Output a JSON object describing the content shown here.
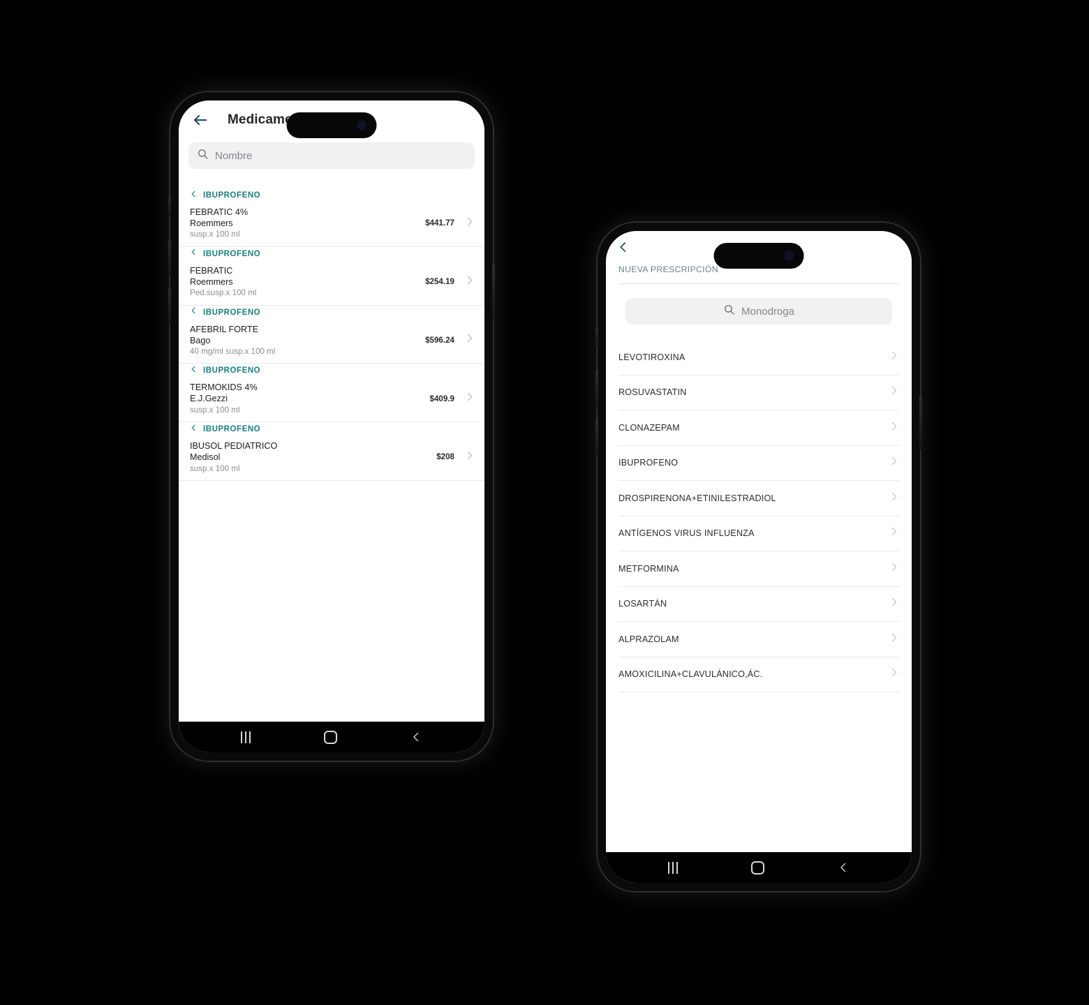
{
  "phone1": {
    "topbar": {
      "back_icon": "arrow-left-icon",
      "title": "Medicamen"
    },
    "search": {
      "icon": "search-icon",
      "placeholder": "Nombre"
    },
    "groups": [
      {
        "monodroga": "IBUPROFENO",
        "name": "FEBRATIC 4%",
        "lab": "Roemmers",
        "presentation": "susp.x 100 ml",
        "price": "$441.77"
      },
      {
        "monodroga": "IBUPROFENO",
        "name": "FEBRATIC",
        "lab": "Roemmers",
        "presentation": "Ped.susp.x 100 ml",
        "price": "$254.19"
      },
      {
        "monodroga": "IBUPROFENO",
        "name": "AFEBRIL FORTE",
        "lab": "Bago",
        "presentation": "40 mg/ml susp.x 100 ml",
        "price": "$596.24"
      },
      {
        "monodroga": "IBUPROFENO",
        "name": "TERMOKIDS 4%",
        "lab": "E.J.Gezzi",
        "presentation": "susp.x 100 ml",
        "price": "$409.9"
      },
      {
        "monodroga": "IBUPROFENO",
        "name": "IBUSOL PEDIATRICO",
        "lab": "Medisol",
        "presentation": "susp.x 100 ml",
        "price": "$208"
      }
    ],
    "navbar": {
      "recents": "recents-icon",
      "home": "home-icon",
      "back": "back-icon"
    }
  },
  "phone2": {
    "topbar": {
      "back_icon": "chevron-left-icon"
    },
    "section_label": "NUEVA PRESCRIPCIÓN",
    "search": {
      "icon": "search-icon",
      "placeholder": "Monodroga"
    },
    "items": [
      {
        "label": "LEVOTIROXINA"
      },
      {
        "label": "ROSUVASTATIN"
      },
      {
        "label": "CLONAZEPAM"
      },
      {
        "label": "IBUPROFENO"
      },
      {
        "label": "DROSPIRENONA+ETINILESTRADIOL"
      },
      {
        "label": "ANTÍGENOS VIRUS INFLUENZA"
      },
      {
        "label": "METFORMINA"
      },
      {
        "label": "LOSARTÁN"
      },
      {
        "label": "ALPRAZOLAM"
      },
      {
        "label": "AMOXICILINA+CLAVULÁNICO,ÁC."
      }
    ],
    "navbar": {
      "recents": "recents-icon",
      "home": "home-icon",
      "back": "back-icon"
    }
  },
  "colors": {
    "background": "#000000",
    "accent_teal": "#1b7c80",
    "back_arrow": "#1f5166",
    "section_label": "#6b7f8a",
    "search_field": "#f1f1f2",
    "placeholder": "#84858a",
    "divider": "#e9e9ea",
    "chevron_gray": "#c0c0c2"
  }
}
